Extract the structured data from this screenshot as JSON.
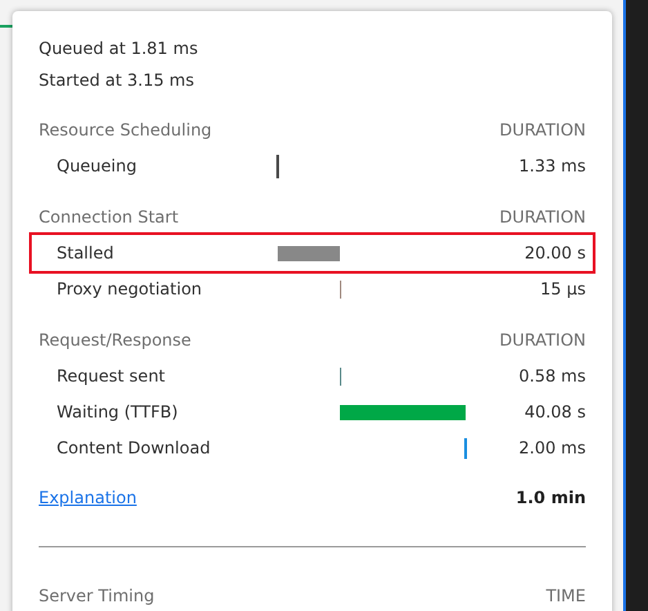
{
  "queued_at": "Queued at 1.81 ms",
  "started_at": "Started at 3.15 ms",
  "sections": [
    {
      "title": "Resource Scheduling",
      "column": "DURATION",
      "rows": [
        {
          "label": "Queueing",
          "duration": "1.33 ms",
          "color": "#4a4a4a",
          "highlighted": false
        }
      ]
    },
    {
      "title": "Connection Start",
      "column": "DURATION",
      "rows": [
        {
          "label": "Stalled",
          "duration": "20.00 s",
          "color": "#888888",
          "highlighted": true
        },
        {
          "label": "Proxy negotiation",
          "duration": "15 µs",
          "color": "#a08a80",
          "highlighted": false
        }
      ]
    },
    {
      "title": "Request/Response",
      "column": "DURATION",
      "rows": [
        {
          "label": "Request sent",
          "duration": "0.58 ms",
          "color": "#5a8a8a",
          "highlighted": false
        },
        {
          "label": "Waiting (TTFB)",
          "duration": "40.08 s",
          "color": "#00a847",
          "highlighted": false
        },
        {
          "label": "Content Download",
          "duration": "2.00 ms",
          "color": "#1a8ee0",
          "highlighted": false
        }
      ]
    }
  ],
  "explanation_link": "Explanation",
  "total": "1.0 min",
  "server_timing": {
    "title": "Server Timing",
    "column": "TIME"
  }
}
